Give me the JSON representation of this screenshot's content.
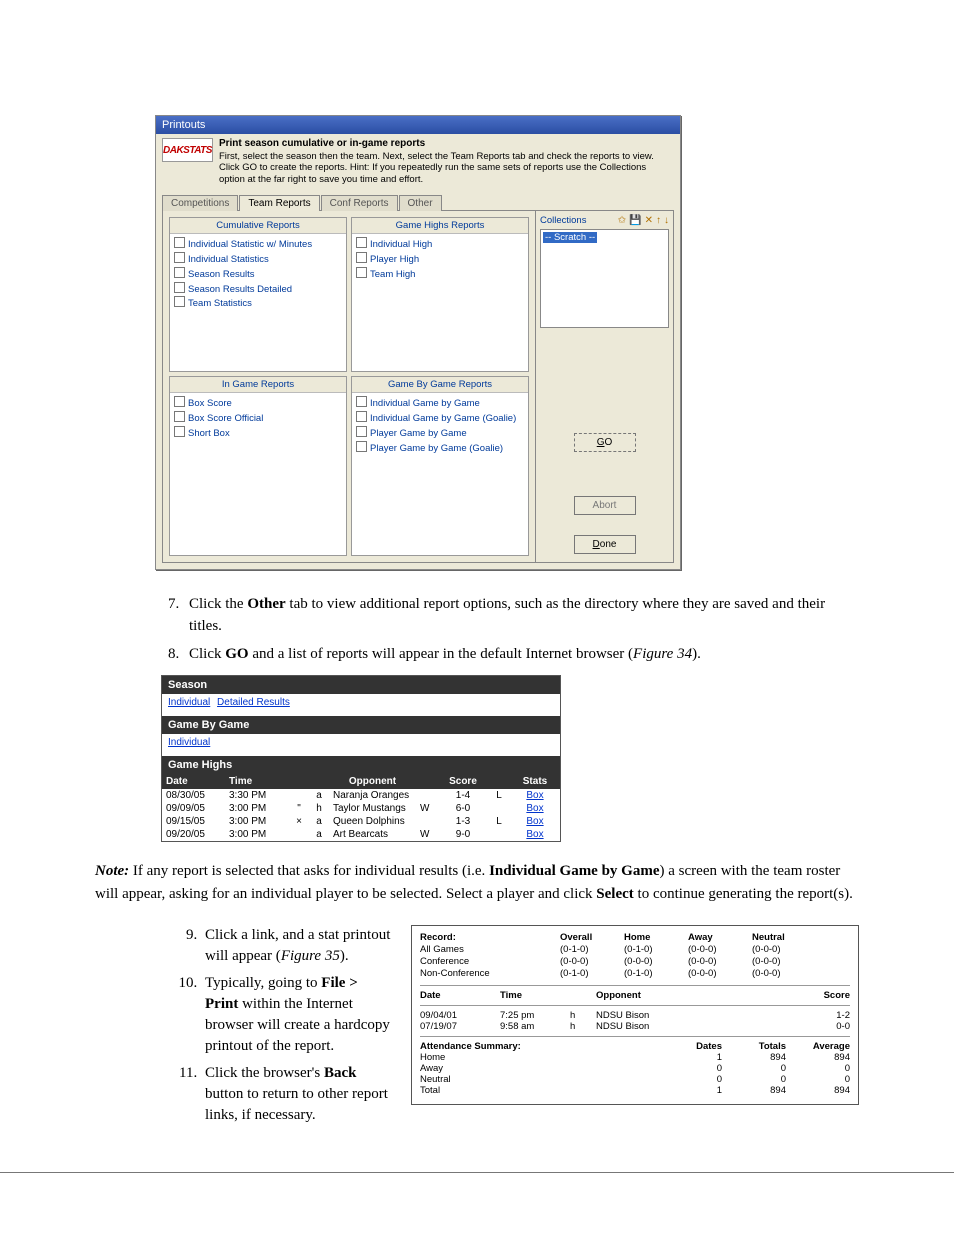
{
  "dialog": {
    "title": "Printouts",
    "logo": "DAKSTATS",
    "head_bold": "Print season cumulative or in-game reports",
    "head_body": "First, select the season then the team. Next, select the Team Reports tab and check the reports to view. Click GO to create the reports. Hint: If you repeatedly run the same sets of reports use the Collections option at the far right to save you time and effort.",
    "tabs": [
      "Competitions",
      "Team Reports",
      "Conf Reports",
      "Other"
    ],
    "boxes": {
      "cumulative": {
        "title": "Cumulative Reports",
        "items": [
          "Individual Statistic w/ Minutes",
          "Individual Statistics",
          "Season Results",
          "Season Results Detailed",
          "Team Statistics"
        ]
      },
      "highs": {
        "title": "Game Highs Reports",
        "items": [
          "Individual High",
          "Player High",
          "Team High"
        ]
      },
      "ingame": {
        "title": "In Game Reports",
        "items": [
          "Box Score",
          "Box Score Official",
          "Short Box"
        ]
      },
      "gbg": {
        "title": "Game By Game Reports",
        "items": [
          "Individual Game by Game",
          "Individual Game by Game (Goalie)",
          "Player Game by Game",
          "Player Game by Game (Goalie)"
        ]
      }
    },
    "collections_label": "Collections",
    "scratch": "Scratch",
    "go_btn": "GO",
    "abort_btn": "Abort",
    "done_btn": "Done"
  },
  "step7": {
    "num": "7.",
    "text_a": "Click the ",
    "bold": "Other",
    "text_b": " tab to view additional report options, such as the directory where they are saved and their titles."
  },
  "step8": {
    "num": "8.",
    "text_a": "Click ",
    "bold": "GO",
    "text_b": " and a list of reports will appear in the default Internet browser (",
    "italic": "Figure 34",
    "text_c": ")."
  },
  "fig2": {
    "season_head": "Season",
    "season_links": [
      "Individual",
      "Detailed Results"
    ],
    "gbg_head": "Game By Game",
    "gbg_links": [
      "Individual"
    ],
    "gh_head": "Game Highs",
    "headers": {
      "date": "Date",
      "time": "Time",
      "opp": "Opponent",
      "score": "Score",
      "stats": "Stats"
    },
    "rows": [
      {
        "date": "08/30/05",
        "time": "3:30 PM",
        "m1": "",
        "m2": "a",
        "opp": "Naranja Oranges",
        "w": "",
        "score": "1-4",
        "r": "L",
        "link": "Box"
      },
      {
        "date": "09/09/05",
        "time": "3:00 PM",
        "m1": "\"",
        "m2": "h",
        "opp": "Taylor Mustangs",
        "w": "W",
        "score": "6-0",
        "r": "",
        "link": "Box"
      },
      {
        "date": "09/15/05",
        "time": "3:00 PM",
        "m1": "×",
        "m2": "a",
        "opp": "Queen Dolphins",
        "w": "",
        "score": "1-3",
        "r": "L",
        "link": "Box"
      },
      {
        "date": "09/20/05",
        "time": "3:00 PM",
        "m1": "",
        "m2": "a",
        "opp": "Art Bearcats",
        "w": "W",
        "score": "9-0",
        "r": "",
        "link": "Box"
      }
    ]
  },
  "note": {
    "label": "Note:",
    "a": " If any report is selected that asks for individual results (i.e. ",
    "b": "Individual Game by Game",
    "c": ") a screen with the team roster will appear, asking for an individual player to be selected. Select a player and click ",
    "d": "Select",
    "e": " to continue generating the report(s)."
  },
  "step9": {
    "a": "Click a link, and a stat printout will appear (",
    "i": "Figure 35",
    "b": ")."
  },
  "step10": {
    "a": "Typically, going to ",
    "b": "File > Print",
    "c": " within the Internet browser will create a hardcopy printout of the report."
  },
  "step11": {
    "a": "Click the browser's ",
    "b": "Back",
    "c": " button to return to other report links, if necessary."
  },
  "fig3": {
    "record_label": "Record:",
    "rows_labels": [
      "All Games",
      "Conference",
      "Non-Conference"
    ],
    "col_heads": [
      "Overall",
      "Home",
      "Away",
      "Neutral"
    ],
    "matrix": [
      [
        "(0-1-0)",
        "(0-1-0)",
        "(0-0-0)",
        "(0-0-0)"
      ],
      [
        "(0-0-0)",
        "(0-0-0)",
        "(0-0-0)",
        "(0-0-0)"
      ],
      [
        "(0-1-0)",
        "(0-1-0)",
        "(0-0-0)",
        "(0-0-0)"
      ]
    ],
    "sched_head": {
      "date": "Date",
      "time": "Time",
      "opp": "Opponent",
      "score": "Score"
    },
    "sched_rows": [
      {
        "date": "09/04/01",
        "time": "7:25 pm",
        "h": "h",
        "opp": "NDSU Bison",
        "score": "1-2"
      },
      {
        "date": "07/19/07",
        "time": "9:58 am",
        "h": "h",
        "opp": "NDSU Bison",
        "score": "0-0"
      }
    ],
    "att_label": "Attendance Summary:",
    "att_heads": [
      "Dates",
      "Totals",
      "Average"
    ],
    "att_rows": [
      {
        "label": "Home",
        "d": "1",
        "t": "894",
        "a": "894"
      },
      {
        "label": "Away",
        "d": "0",
        "t": "0",
        "a": "0"
      },
      {
        "label": "Neutral",
        "d": "0",
        "t": "0",
        "a": "0"
      },
      {
        "label": "Total",
        "d": "1",
        "t": "894",
        "a": "894"
      }
    ]
  }
}
